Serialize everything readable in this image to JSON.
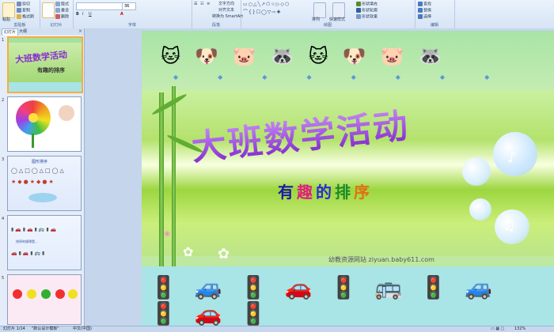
{
  "ribbon": {
    "clipboard": {
      "paste": "粘贴",
      "cut": "剪切",
      "copy": "复制",
      "format_painter": "格式刷",
      "label": "剪贴板"
    },
    "slides": {
      "new_slide": "新建幻灯片",
      "layout": "版式",
      "reset": "重设",
      "delete": "删除",
      "label": "幻灯片"
    },
    "font": {
      "font_size": "36",
      "label": "字体"
    },
    "paragraph": {
      "text_direction": "文字方向",
      "align_text": "对齐文本",
      "convert_smartart": "转换为 SmartArt",
      "label": "段落"
    },
    "drawing": {
      "arrange": "排列",
      "quick_styles": "快速样式",
      "shape_fill": "形状填充",
      "shape_outline": "形状轮廓",
      "shape_effects": "形状效果",
      "label": "绘图"
    },
    "editing": {
      "find": "查找",
      "replace": "替换",
      "select": "选择",
      "label": "编辑"
    }
  },
  "leftpane": {
    "tab_slides": "幻灯片",
    "tab_outline": "大纲",
    "close": "×",
    "thumbs": [
      {
        "num": "1",
        "title": "大班数学活动",
        "sub": "有趣的排序"
      },
      {
        "num": "2"
      },
      {
        "num": "3",
        "title": "图形排序"
      },
      {
        "num": "4",
        "text": "排序的规律是..."
      },
      {
        "num": "5"
      }
    ]
  },
  "slide": {
    "title": "大班数学活动",
    "subtitle_chars": [
      "有",
      "趣",
      "的",
      "排",
      "序"
    ],
    "subtitle_colors": [
      "#1a1aa0",
      "#e0207a",
      "#2a2ad0",
      "#1a8a2a",
      "#e07010"
    ],
    "watermark": "幼教资源网站  ziyuan.baby611.com"
  },
  "status": {
    "slide_count": "幻灯片 1/14",
    "theme": "\"默认设计模板\"",
    "language": "中文(中国)",
    "zoom": "132%"
  }
}
